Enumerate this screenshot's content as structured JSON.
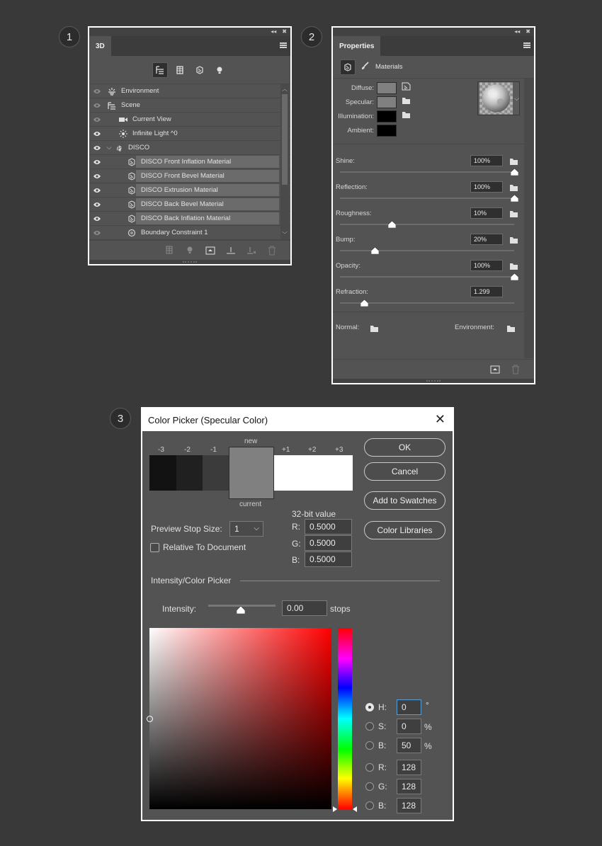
{
  "steps": [
    "1",
    "2",
    "3"
  ],
  "panel3d": {
    "tab": "3D",
    "header_icons": [
      "collapse-icon",
      "close-icon"
    ],
    "rows": [
      {
        "label": "Environment",
        "icon": "environment-icon",
        "visible_dim": true,
        "indent": 0
      },
      {
        "label": "Scene",
        "icon": "scene-icon",
        "visible_dim": true,
        "indent": 0
      },
      {
        "label": "Current View",
        "icon": "camera-icon",
        "visible_dim": true,
        "indent": 1
      },
      {
        "label": "Infinite Light ^0",
        "icon": "light-icon",
        "visible_dim": false,
        "indent": 1
      },
      {
        "label": "DISCO",
        "icon": "mesh-icon",
        "visible_dim": false,
        "indent": 0
      },
      {
        "label": "DISCO Front Inflation Material",
        "icon": "material-icon",
        "selected": true
      },
      {
        "label": "DISCO Front Bevel Material",
        "icon": "material-icon",
        "selected": true
      },
      {
        "label": "DISCO Extrusion Material",
        "icon": "material-icon",
        "selected": true
      },
      {
        "label": "DISCO Back Bevel Material",
        "icon": "material-icon",
        "selected": true
      },
      {
        "label": "DISCO Back Inflation Material",
        "icon": "material-icon",
        "selected": true
      },
      {
        "label": "Boundary Constraint 1",
        "icon": "constraint-icon",
        "visible_dim": true
      }
    ]
  },
  "properties": {
    "tab": "Properties",
    "mode_label": "Materials",
    "colors": [
      {
        "label": "Diffuse:",
        "swatch": "#808080"
      },
      {
        "label": "Specular:",
        "swatch": "#808080"
      },
      {
        "label": "Illumination:",
        "swatch": "#000000"
      },
      {
        "label": "Ambient:",
        "swatch": "#000000"
      }
    ],
    "sliders": [
      {
        "label": "Shine:",
        "value": "100%",
        "level": 1.0
      },
      {
        "label": "Reflection:",
        "value": "100%",
        "level": 1.0
      },
      {
        "label": "Roughness:",
        "value": "10%",
        "level": 0.3
      },
      {
        "label": "Bump:",
        "value": "20%",
        "level": 0.2
      },
      {
        "label": "Opacity:",
        "value": "100%",
        "level": 1.0
      },
      {
        "label": "Refraction:",
        "value": "1.299",
        "level": 0.14
      }
    ],
    "normal_label": "Normal:",
    "environment_label": "Environment:"
  },
  "picker": {
    "title": "Color Picker (Specular Color)",
    "close": "✕",
    "stop_labels_neg": [
      "-3",
      "-2",
      "-1"
    ],
    "stop_labels_pos": [
      "+1",
      "+2",
      "+3"
    ],
    "new_label": "new",
    "current_label": "current",
    "stop_colors": [
      "#121212",
      "#202020",
      "#3b3b3b",
      "#808080",
      "#ffffff"
    ],
    "ok": "OK",
    "cancel": "Cancel",
    "add_swatches": "Add to Swatches",
    "color_libraries": "Color Libraries",
    "preview_stop_label": "Preview Stop Size:",
    "preview_stop_value": "1",
    "relative_label": "Relative To Document",
    "bit_label": "32-bit value",
    "r_label": "R:",
    "r_value": "0.5000",
    "g_label": "G:",
    "g_value": "0.5000",
    "b_label": "B:",
    "b_value": "0.5000",
    "section_label": "Intensity/Color Picker",
    "intensity_label": "Intensity:",
    "intensity_value": "0.00",
    "intensity_unit": "stops",
    "hsb": [
      {
        "label": "H:",
        "value": "0",
        "unit": "°",
        "checked": true
      },
      {
        "label": "S:",
        "value": "0",
        "unit": "%",
        "checked": false
      },
      {
        "label": "B:",
        "value": "50",
        "unit": "%",
        "checked": false
      }
    ],
    "rgb": [
      {
        "label": "R:",
        "value": "128"
      },
      {
        "label": "G:",
        "value": "128"
      },
      {
        "label": "B:",
        "value": "128"
      }
    ]
  }
}
